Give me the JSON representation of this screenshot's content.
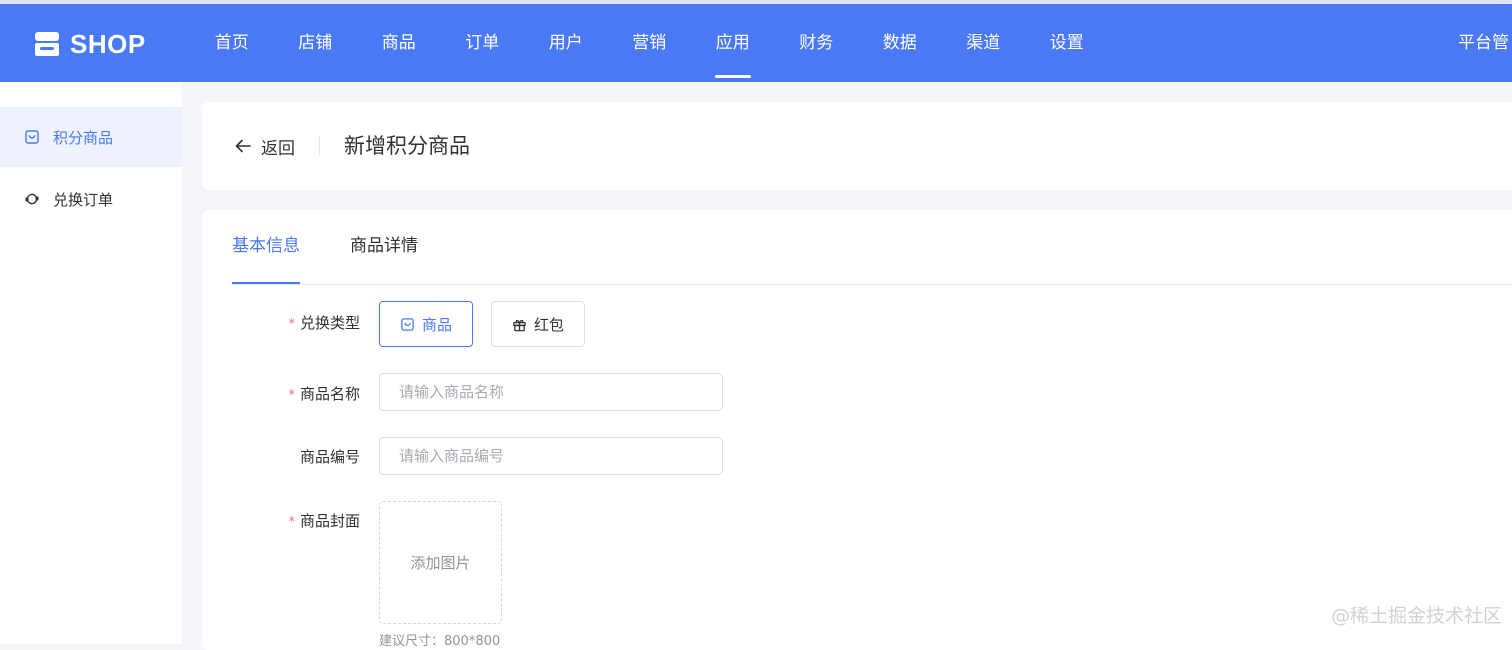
{
  "app": {
    "logo_text": "SHOP"
  },
  "nav": {
    "items": [
      "首页",
      "店铺",
      "商品",
      "订单",
      "用户",
      "营销",
      "应用",
      "财务",
      "数据",
      "渠道",
      "设置"
    ],
    "active_index": 6,
    "right_text": "平台管"
  },
  "sidebar": {
    "items": [
      {
        "label": "积分商品",
        "icon": "shopping-bag-icon",
        "active": true
      },
      {
        "label": "兑换订单",
        "icon": "exchange-icon",
        "active": false
      }
    ]
  },
  "header": {
    "back_label": "返回",
    "title": "新增积分商品"
  },
  "tabs": [
    {
      "label": "基本信息",
      "active": true
    },
    {
      "label": "商品详情",
      "active": false
    }
  ],
  "form": {
    "exchange_type": {
      "label": "兑换类型",
      "required": true,
      "options": [
        {
          "label": "商品",
          "icon": "shopping-bag-icon",
          "selected": true
        },
        {
          "label": "红包",
          "icon": "gift-icon",
          "selected": false
        }
      ]
    },
    "product_name": {
      "label": "商品名称",
      "required": true,
      "placeholder": "请输入商品名称",
      "value": ""
    },
    "product_code": {
      "label": "商品编号",
      "required": false,
      "placeholder": "请输入商品编号",
      "value": ""
    },
    "cover": {
      "label": "商品封面",
      "required": true,
      "upload_label": "添加图片",
      "hint": "建议尺寸：800*800"
    }
  },
  "watermark": "@稀土掘金技术社区",
  "colors": {
    "primary": "#4a79f5",
    "required": "#f56c6c"
  }
}
